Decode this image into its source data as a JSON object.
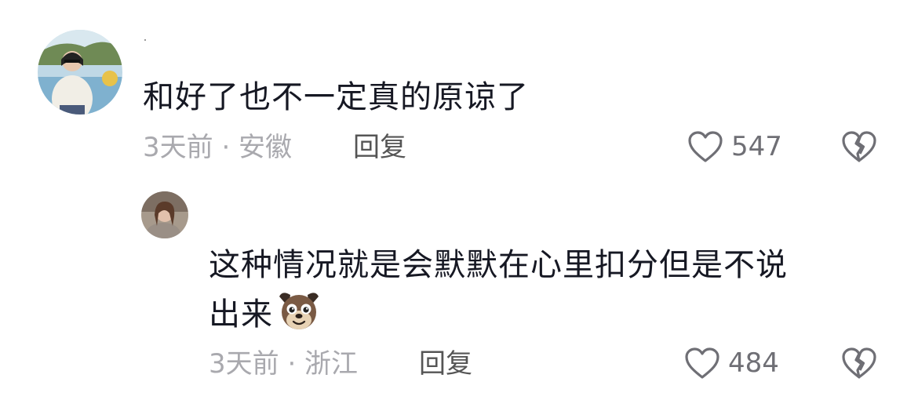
{
  "comments": [
    {
      "text": "和好了也不一定真的原谅了",
      "time_location": "3天前 · 安徽",
      "reply_label": "回复",
      "likes": "547"
    }
  ],
  "reply_comment": {
    "text_line1": "这种情况就是会默默在心里扣分但是不说",
    "text_line2": "出来",
    "time_location": "3天前 · 浙江",
    "reply_label": "回复",
    "likes": "484",
    "emoji_icon": "dog-face-emoji"
  },
  "icons": {
    "like": "heart-outline-icon",
    "dislike": "broken-heart-icon"
  },
  "colors": {
    "text": "#161823",
    "meta": "#a9a9ae",
    "reply": "#555555",
    "icon": "#6f6f75"
  }
}
